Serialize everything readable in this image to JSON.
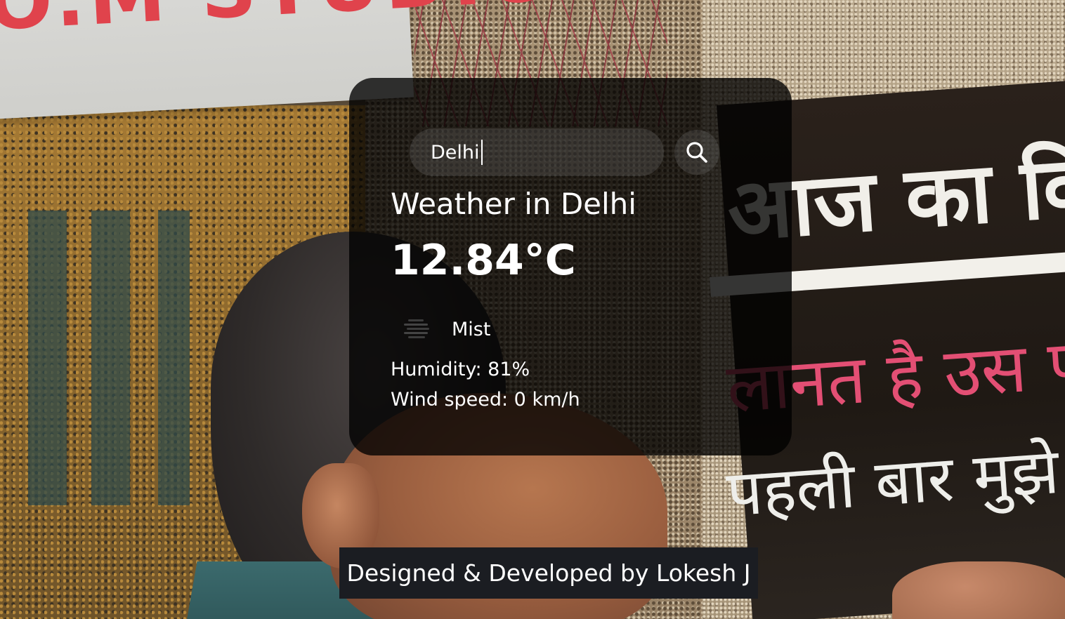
{
  "background": {
    "banner_text": "O.M STUDIO",
    "board_line_1": "आज का विचार",
    "board_line_2": "लानत है उस पर",
    "board_line_3": "पहली बार मुझे"
  },
  "search": {
    "value": "Delhi",
    "placeholder": "",
    "button_icon": "search-icon"
  },
  "weather": {
    "title": "Weather in Delhi",
    "temperature": "12.84°C",
    "condition_icon": "mist-icon",
    "condition": "Mist",
    "humidity": "Humidity: 81%",
    "wind": "Wind speed: 0 km/h"
  },
  "footer": {
    "credit": "Designed & Developed by Lokesh J"
  },
  "colors": {
    "card_background": "#000000",
    "text": "#ffffff",
    "credit_background": "#1b1d22"
  }
}
